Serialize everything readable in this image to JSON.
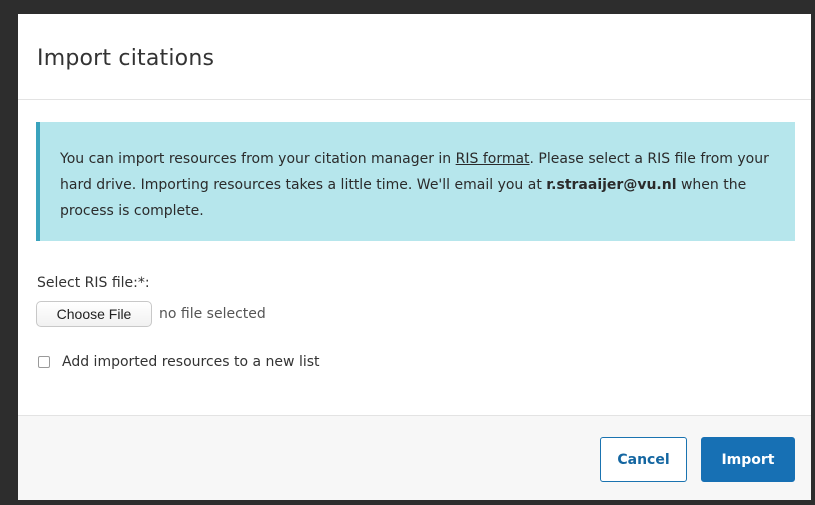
{
  "modal": {
    "title": "Import citations"
  },
  "info": {
    "text_before_link": "You can import resources from your citation manager in ",
    "link_text": "RIS format",
    "text_after_link": ". Please select a RIS file from your hard drive. Importing resources takes a little time. We'll email you at ",
    "email": "r.straaijer@vu.nl",
    "text_end": " when the process is complete."
  },
  "form": {
    "file_label": "Select RIS file:*:",
    "choose_file_label": "Choose File",
    "file_status": "no file selected",
    "checkbox_label": "Add imported resources to a new list",
    "checkbox_checked": false
  },
  "footer": {
    "cancel_label": "Cancel",
    "import_label": "Import"
  },
  "colors": {
    "primary": "#1770b4",
    "info_background": "#b6e6ec",
    "info_border": "#3aa3bd"
  }
}
